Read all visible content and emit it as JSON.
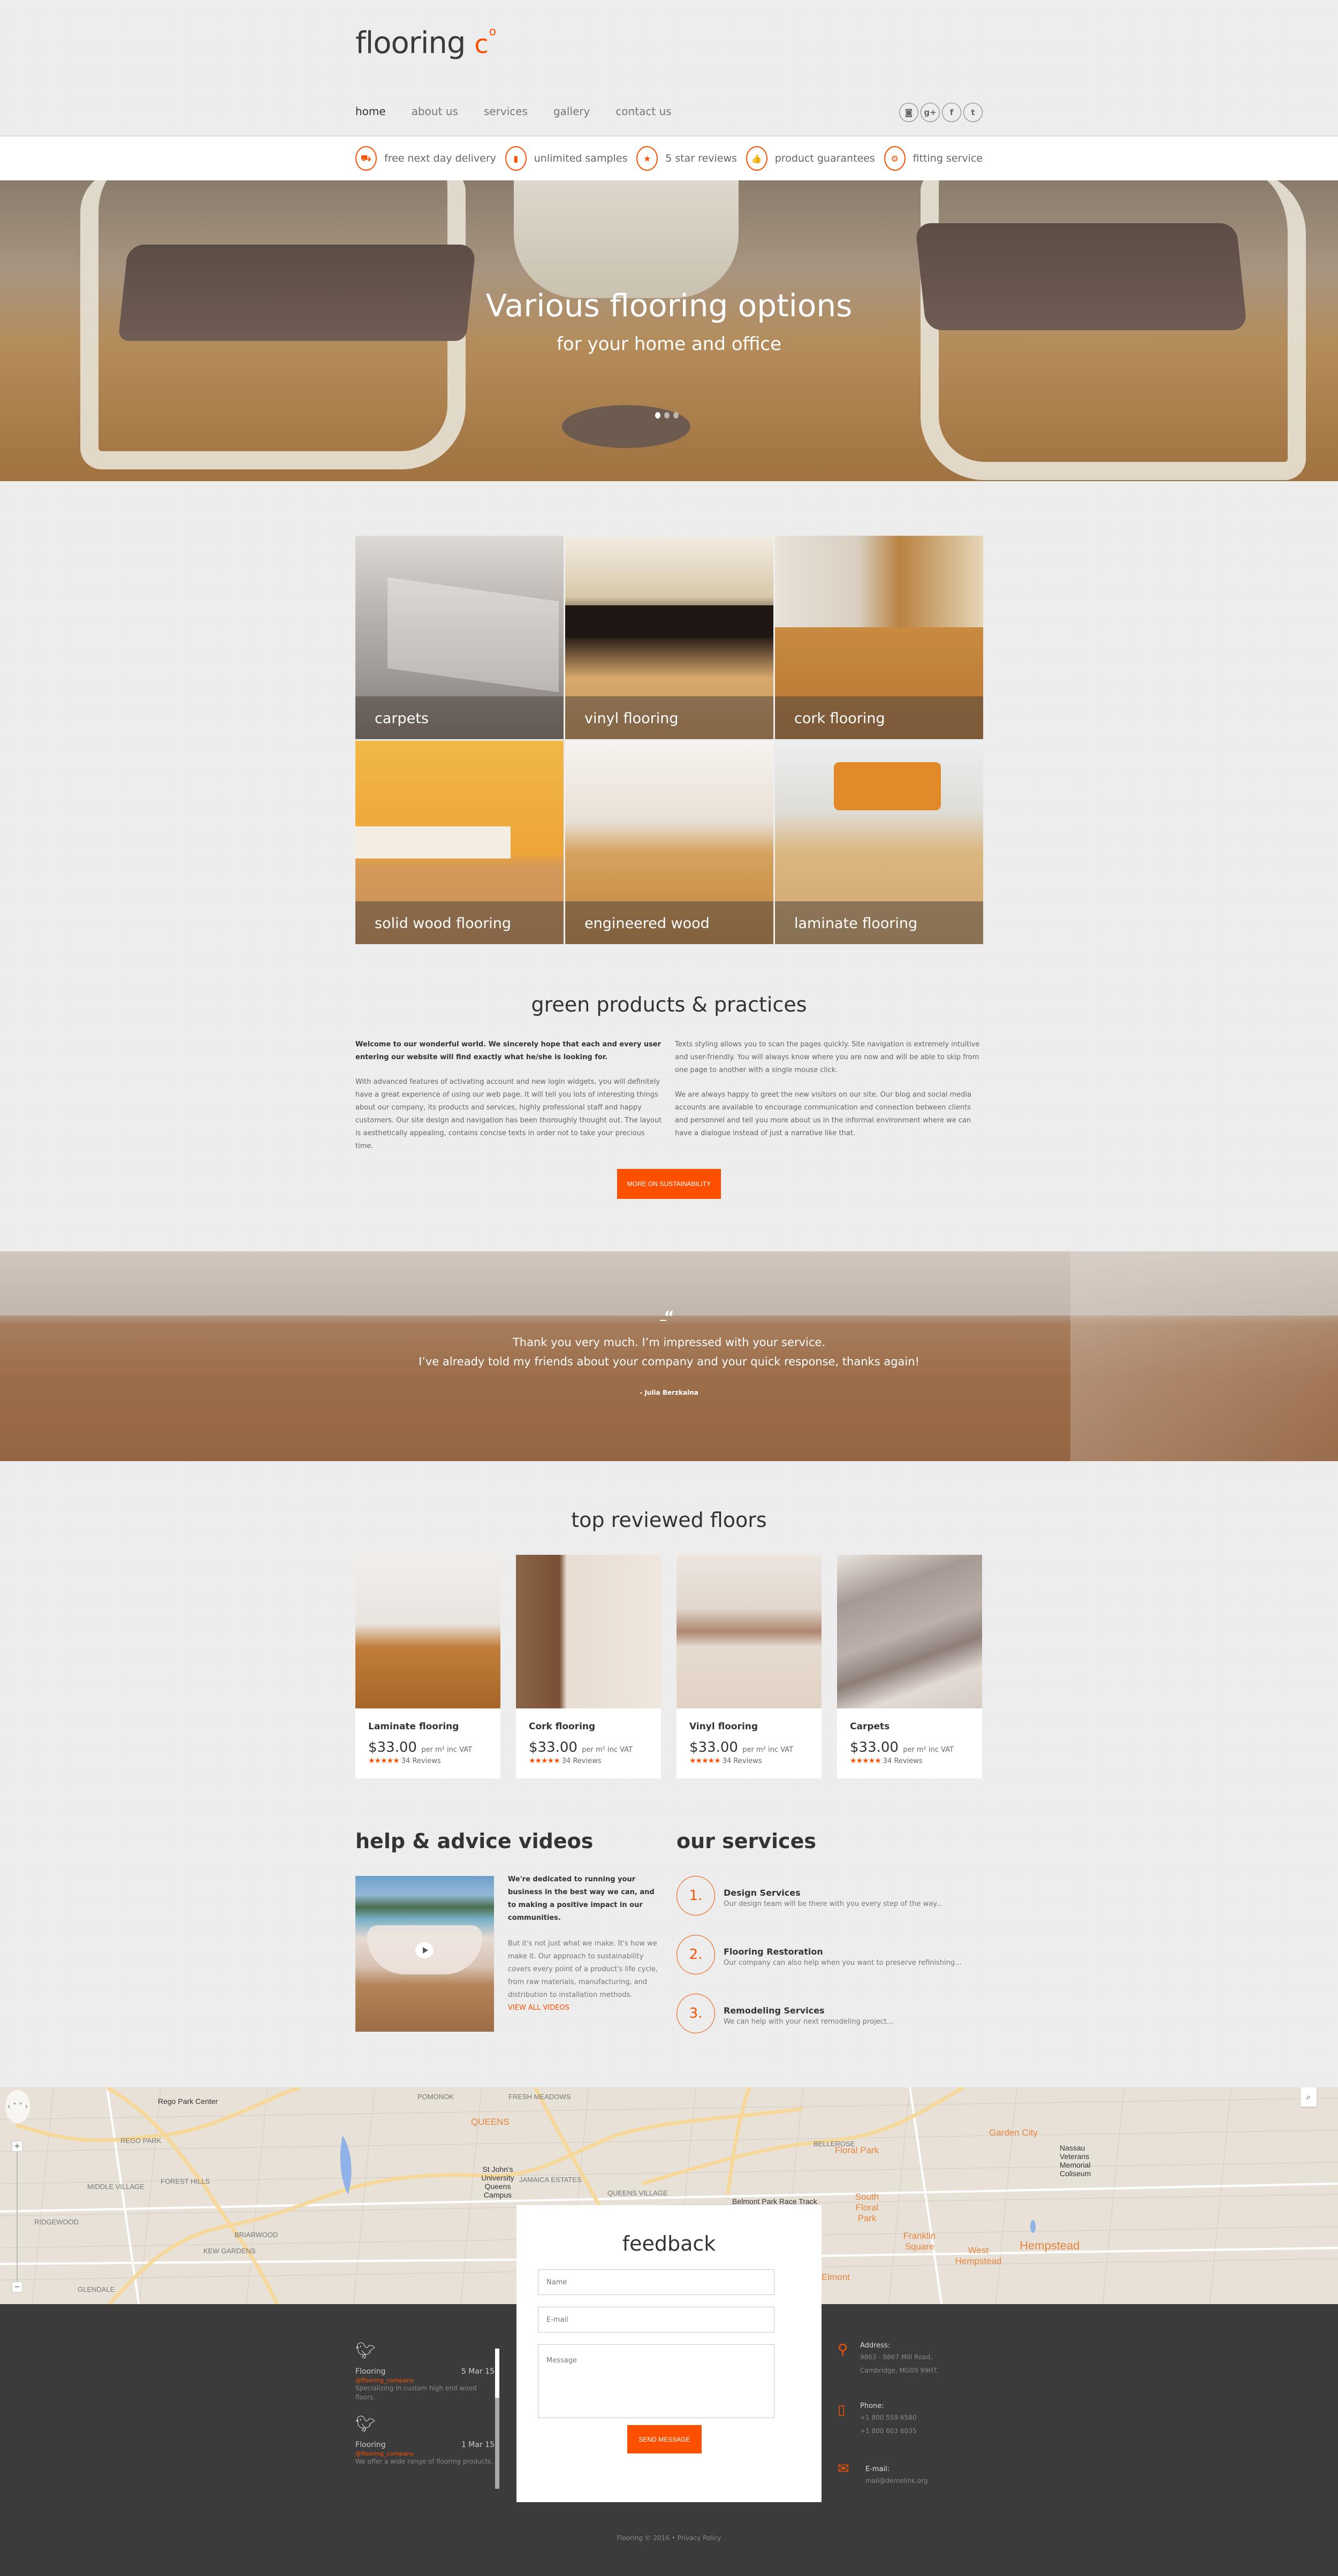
{
  "header": {
    "logo_text": "flooring",
    "logo_suffix": "c",
    "logo_sup": "o",
    "nav": [
      {
        "label": "home",
        "active": true
      },
      {
        "label": "about us"
      },
      {
        "label": "services"
      },
      {
        "label": "gallery"
      },
      {
        "label": "contact us"
      }
    ],
    "social": [
      {
        "icon": "instagram-icon",
        "glyph": "◙"
      },
      {
        "icon": "google-plus-icon",
        "glyph": "g+"
      },
      {
        "icon": "facebook-icon",
        "glyph": "f"
      },
      {
        "icon": "twitter-icon",
        "glyph": "t"
      }
    ]
  },
  "features": [
    {
      "icon": "truck-icon",
      "glyph": "⛟",
      "label": "free next day delivery"
    },
    {
      "icon": "samples-icon",
      "glyph": "▮",
      "label": "unlimited samples"
    },
    {
      "icon": "star-icon",
      "glyph": "★",
      "label": "5 star reviews"
    },
    {
      "icon": "thumbs-up-icon",
      "glyph": "👍",
      "label": "product guarantees"
    },
    {
      "icon": "gear-icon",
      "glyph": "⚙",
      "label": "fitting service"
    }
  ],
  "hero": {
    "title": "Various flooring options",
    "subtitle": "for your home and office",
    "slides": 3,
    "active_slide": 1
  },
  "categories": [
    {
      "label": "carpets"
    },
    {
      "label": "vinyl flooring"
    },
    {
      "label": "cork flooring"
    },
    {
      "label": "solid wood flooring"
    },
    {
      "label": "engineered wood"
    },
    {
      "label": "laminate flooring"
    }
  ],
  "green": {
    "title": "green products & practices",
    "left_bold": "Welcome to our wonderful world. We sincerely hope that each and every user entering our website will find exactly what he/she is looking for.",
    "left_body": "With advanced features of activating account and new login widgets, you will definitely have a great experience of using our web page. It will tell you lots of interesting things about our company, its products and services, highly professional staff and happy customers. Our site design and navigation has been thoroughly thought out. The layout is aesthetically appealing, contains concise texts in order not to take your precious time.",
    "right_p1": "Texts styling allows you to scan the pages quickly. Site navigation is extremely intuitive and user-friendly. You will always know where you are now and will be able to skip from one page to another with a single mouse click.",
    "right_p2": "We are always happy to greet the new visitors on our site. Our blog and social media accounts are available to encourage communication and connection between clients and personnel and tell you more about us in the informal environment where we can have a dialogue instead of just a narrative like that.",
    "button": "More on sustainability"
  },
  "testimonial": {
    "quote_mark": "“",
    "line1": "Thank you very much. I’m impressed with your service.",
    "line2": "I’ve already told my friends about your company and your quick response, thanks again!",
    "author": "- Julia Berzkalna"
  },
  "top_reviewed": {
    "title": "top reviewed floors",
    "products": [
      {
        "name": "Laminate flooring",
        "price": "$33.00",
        "unit": "per m² inc VAT",
        "stars": 5,
        "reviews": "34 Reviews"
      },
      {
        "name": "Cork flooring",
        "price": "$33.00",
        "unit": "per m² inc VAT",
        "stars": 5,
        "reviews": "34 Reviews"
      },
      {
        "name": "Vinyl flooring",
        "price": "$33.00",
        "unit": "per m² inc VAT",
        "stars": 5,
        "reviews": "34 Reviews"
      },
      {
        "name": "Carpets",
        "price": "$33.00",
        "unit": "per m² inc VAT",
        "stars": 5,
        "reviews": "34 Reviews"
      }
    ],
    "stars_glyph": "★★★★★"
  },
  "help": {
    "title": "help & advice videos",
    "bold": "We're dedicated to running your business in the best way we can, and to making a positive impact in our communities.",
    "body": "But it's not just what we make. It's how we make it. Our approach to sustainability covers every point of a product's life cycle, from raw materials, manufacturing, and distribution to installation methods.",
    "link": "View all videos"
  },
  "services": {
    "title": "our services",
    "items": [
      {
        "num": "1.",
        "title": "Design Services",
        "desc": "Our design team will be there with you every step of the way..."
      },
      {
        "num": "2.",
        "title": "Flooring Restoration",
        "desc": "Our company can also help when you want to preserve refinishing..."
      },
      {
        "num": "3.",
        "title": "Remodeling Services",
        "desc": "We can help with your next remodeling project..."
      }
    ]
  },
  "map": {
    "labels": [
      {
        "text": "Rego Park Center",
        "kind": "d"
      },
      {
        "text": "REGO PARK"
      },
      {
        "text": "MIDDLE VILLAGE"
      },
      {
        "text": "FOREST HILLS"
      },
      {
        "text": "RIDGEWOOD"
      },
      {
        "text": "KEW GARDENS"
      },
      {
        "text": "GLENDALE"
      },
      {
        "text": "BRIARWOOD"
      },
      {
        "text": "POMONOK"
      },
      {
        "text": "FRESH MEADOWS"
      },
      {
        "text": "QUEENS",
        "kind": "o"
      },
      {
        "text": "St John's University Queens Campus",
        "kind": "d"
      },
      {
        "text": "JAMAICA ESTATES"
      },
      {
        "text": "QUEENS VILLAGE"
      },
      {
        "text": "Belmont Park Race Track",
        "kind": "d"
      },
      {
        "text": "BELLEROSE"
      },
      {
        "text": "Floral Park",
        "kind": "o"
      },
      {
        "text": "South Floral Park",
        "kind": "o"
      },
      {
        "text": "Garden City",
        "kind": "o"
      },
      {
        "text": "Franklin Square",
        "kind": "o"
      },
      {
        "text": "West Hempstead",
        "kind": "o"
      },
      {
        "text": "Hempstead",
        "kind": "o"
      },
      {
        "text": "Elmont",
        "kind": "o"
      },
      {
        "text": "Nassau Veterans Memorial Coliseum",
        "kind": "d"
      }
    ],
    "pan_glyph": "‹ ˄ ˅ ›",
    "zoom_in": "+",
    "zoom_out": "−",
    "search_glyph": "⌕"
  },
  "footer": {
    "tweets": [
      {
        "name": "Flooring",
        "date": "5 Mar 15",
        "handle": "@flooring_company",
        "text": "Specializing in custom high end wood floors."
      },
      {
        "name": "Flooring",
        "date": "1 Mar 15",
        "handle": "@flooring_company",
        "text": "We offer a wide range of flooring products."
      }
    ],
    "feedback": {
      "title": "feedback",
      "name_placeholder": "Name",
      "email_placeholder": "E-mail",
      "message_placeholder": "Message",
      "button": "Send message"
    },
    "contact": {
      "address_label": "Address:",
      "address_lines": [
        "9863 - 9867 Mill Road,",
        "Cambridge, MG09 99HT."
      ],
      "phone_label": "Phone:",
      "phones": [
        "+1 800 559 6580",
        "+1 800 603 6035"
      ],
      "email_label": "E-mail:",
      "email": "mail@demolink.org"
    },
    "copyright": "Flooring © 2016 • Privacy Policy"
  },
  "colors": {
    "accent": "#fc5000",
    "footer_bg": "#3b3b3b",
    "text_dark": "#333333"
  }
}
